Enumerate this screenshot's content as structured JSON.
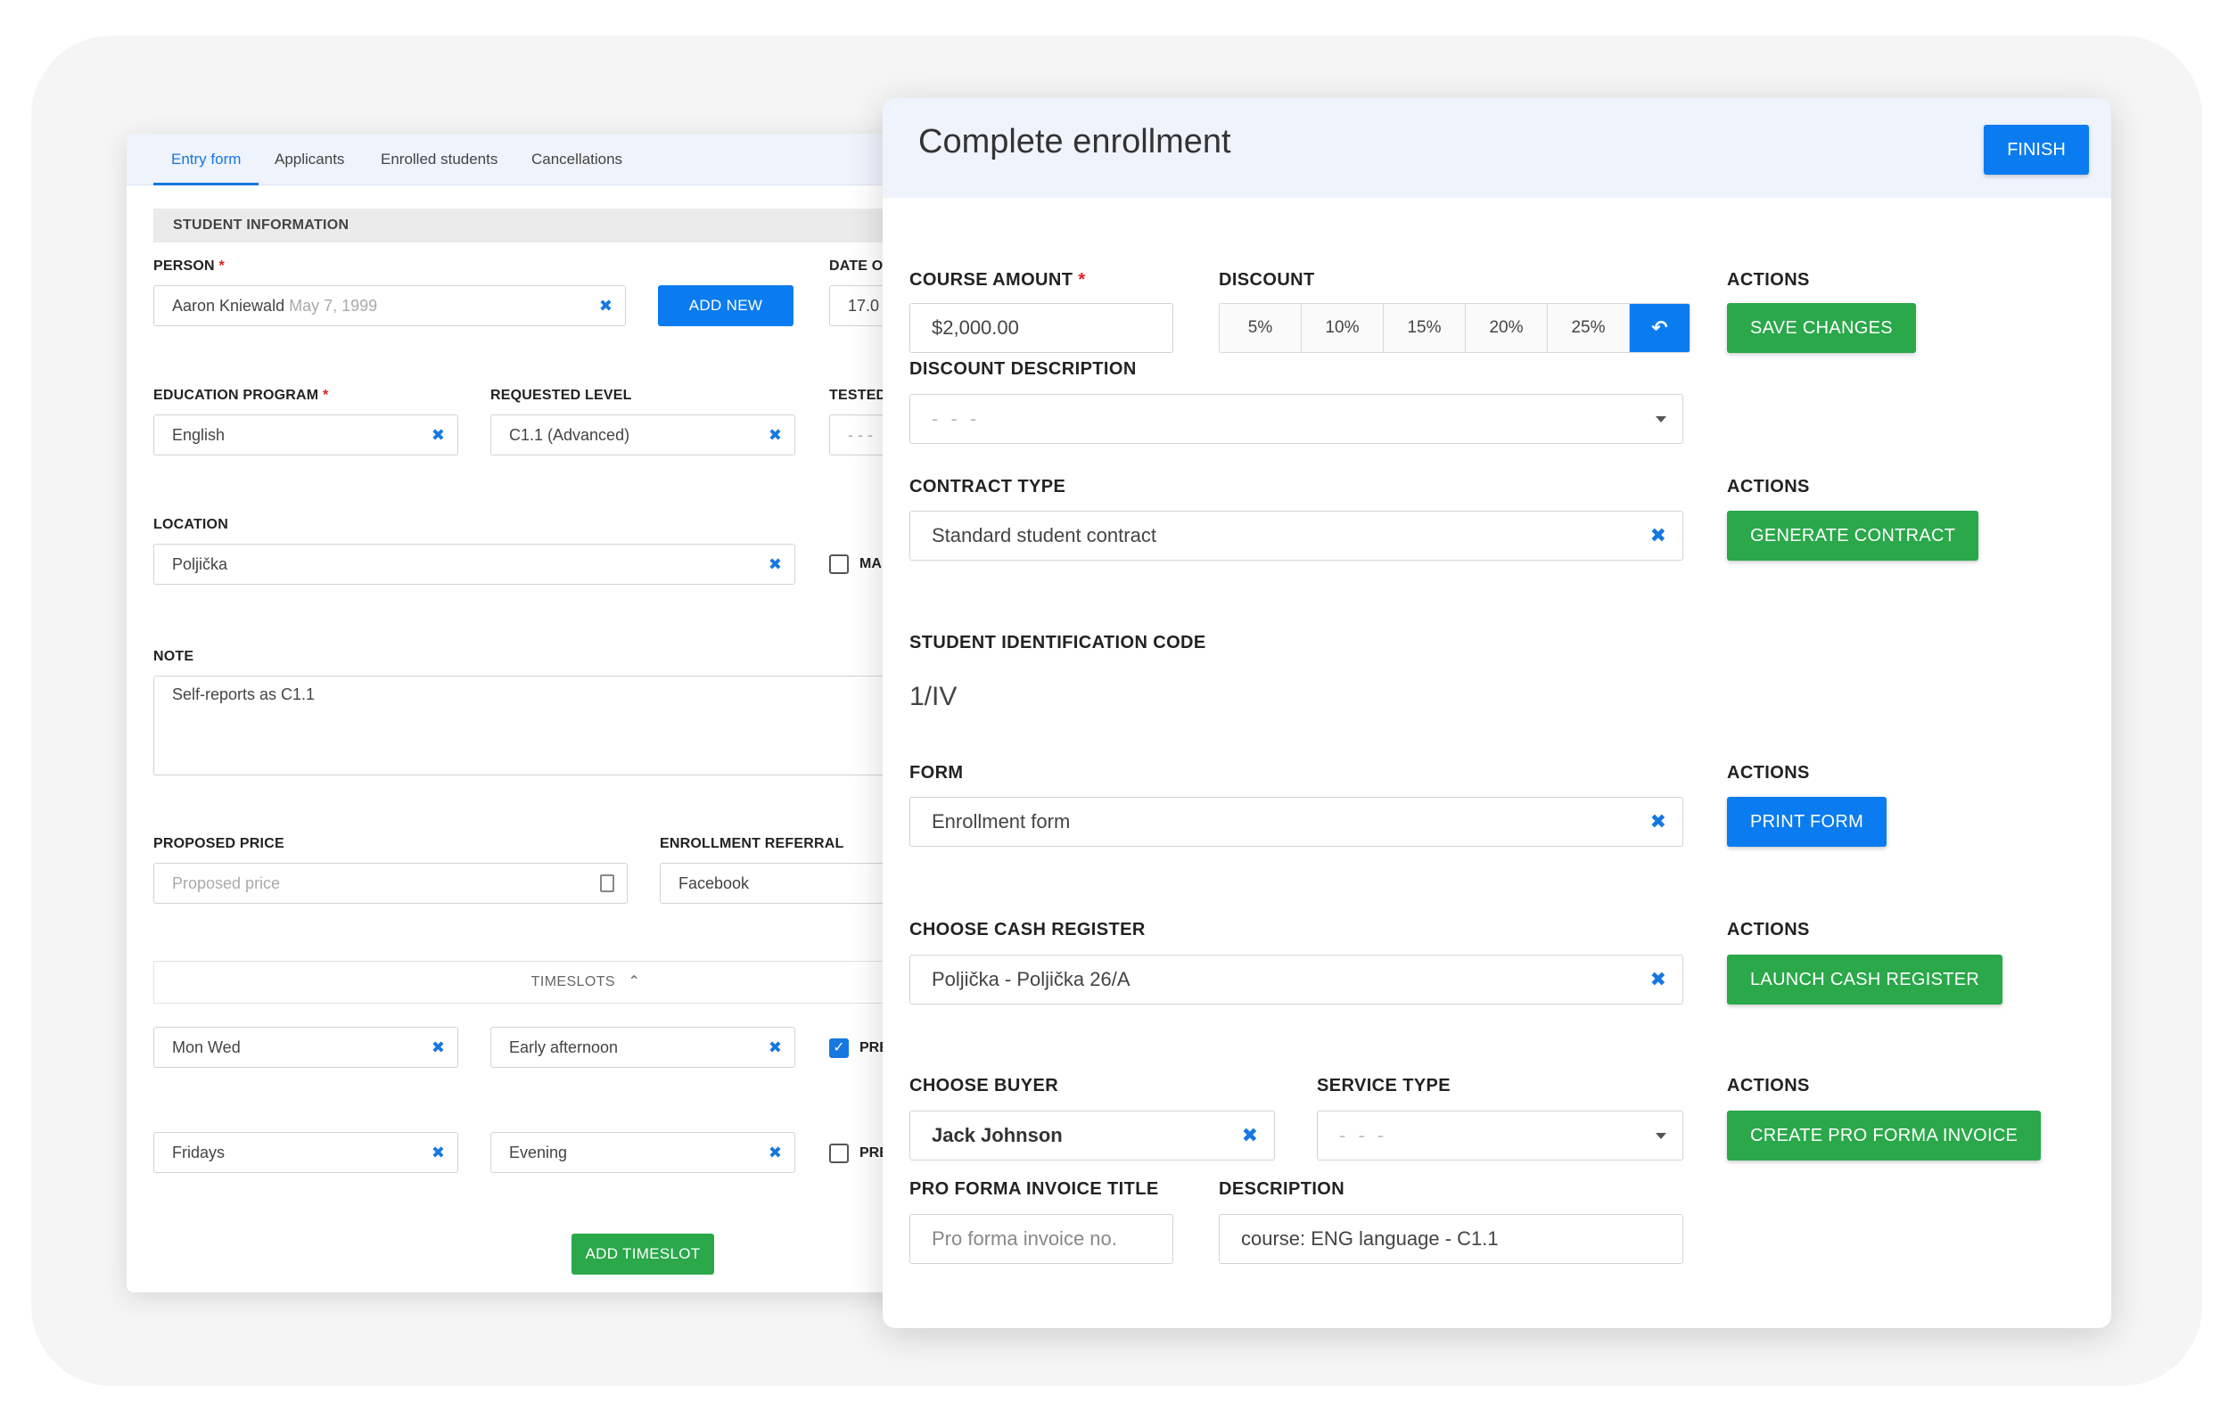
{
  "entry_panel": {
    "tabs": [
      "Entry form",
      "Applicants",
      "Enrolled students",
      "Cancellations"
    ],
    "section_title": "STUDENT INFORMATION",
    "person": {
      "label": "PERSON",
      "name": "Aaron Kniewald",
      "dob": "May 7, 1999"
    },
    "add_new_label": "ADD NEW",
    "date_label": "DATE O",
    "date_value": "17.0",
    "education_program": {
      "label": "EDUCATION PROGRAM",
      "value": "English"
    },
    "requested_level": {
      "label": "REQUESTED LEVEL",
      "value": "C1.1 (Advanced)"
    },
    "tested_label": "TESTED",
    "tested_value": "- - -",
    "location": {
      "label": "LOCATION",
      "value": "Poljička"
    },
    "ma_label": "MA",
    "note": {
      "label": "NOTE",
      "value": "Self-reports as C1.1"
    },
    "proposed_price": {
      "label": "PROPOSED PRICE",
      "placeholder": "Proposed price"
    },
    "enrollment_referral": {
      "label": "ENROLLMENT REFERRAL",
      "value": "Facebook"
    },
    "timeslots_label": "TIMESLOTS",
    "timeslots": [
      {
        "days": "Mon Wed",
        "time": "Early afternoon",
        "checked": true,
        "flag": "PRE"
      },
      {
        "days": "Fridays",
        "time": "Evening",
        "checked": false,
        "flag": "PRE"
      }
    ],
    "add_timeslot_label": "ADD TIMESLOT"
  },
  "enrollment_panel": {
    "title": "Complete enrollment",
    "finish_label": "FINISH",
    "course_amount": {
      "label": "COURSE AMOUNT",
      "value": "$2,000.00"
    },
    "discount": {
      "label": "DISCOUNT",
      "options": [
        "5%",
        "10%",
        "15%",
        "20%",
        "25%"
      ],
      "undo_icon": "↶"
    },
    "actions_label": "ACTIONS",
    "save_changes_label": "SAVE CHANGES",
    "discount_description": {
      "label": "DISCOUNT DESCRIPTION",
      "value": "- - -"
    },
    "contract_type": {
      "label": "CONTRACT TYPE",
      "value": "Standard student contract"
    },
    "generate_contract_label": "GENERATE CONTRACT",
    "student_id": {
      "label": "STUDENT IDENTIFICATION CODE",
      "value": "1/IV"
    },
    "form": {
      "label": "FORM",
      "value": "Enrollment form"
    },
    "print_form_label": "PRINT FORM",
    "cash_register": {
      "label": "CHOOSE CASH REGISTER",
      "value": "Poljička - Poljička 26/A"
    },
    "launch_cash_register_label": "LAUNCH CASH REGISTER",
    "buyer": {
      "label": "CHOOSE BUYER",
      "value": "Jack Johnson"
    },
    "service_type": {
      "label": "SERVICE TYPE",
      "value": "- - -"
    },
    "create_invoice_label": "CREATE PRO FORMA INVOICE",
    "invoice_title": {
      "label": "PRO FORMA INVOICE TITLE",
      "placeholder": "Pro forma invoice no."
    },
    "description": {
      "label": "DESCRIPTION",
      "value": "course: ENG language - C1.1"
    }
  },
  "colors": {
    "primary": "#0a7cf0",
    "success": "#2aa84a",
    "header_bg": "#eef3fc",
    "required": "#e02020"
  }
}
